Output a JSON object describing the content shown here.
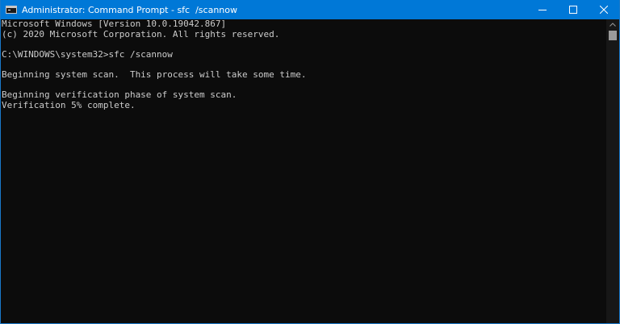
{
  "window": {
    "title": "Administrator: Command Prompt - sfc  /scannow",
    "icon": "cmd-icon",
    "controls": [
      "minimize-icon",
      "maximize-icon",
      "close-icon"
    ]
  },
  "console": {
    "lines": [
      "Microsoft Windows [Version 10.0.19042.867]",
      "(c) 2020 Microsoft Corporation. All rights reserved.",
      "",
      "C:\\WINDOWS\\system32>sfc /scannow",
      "",
      "Beginning system scan.  This process will take some time.",
      "",
      "Beginning verification phase of system scan.",
      "Verification 5% complete."
    ]
  },
  "colors": {
    "titlebar": "#0078d7",
    "console_bg": "#0c0c0c",
    "console_text": "#cccccc"
  }
}
